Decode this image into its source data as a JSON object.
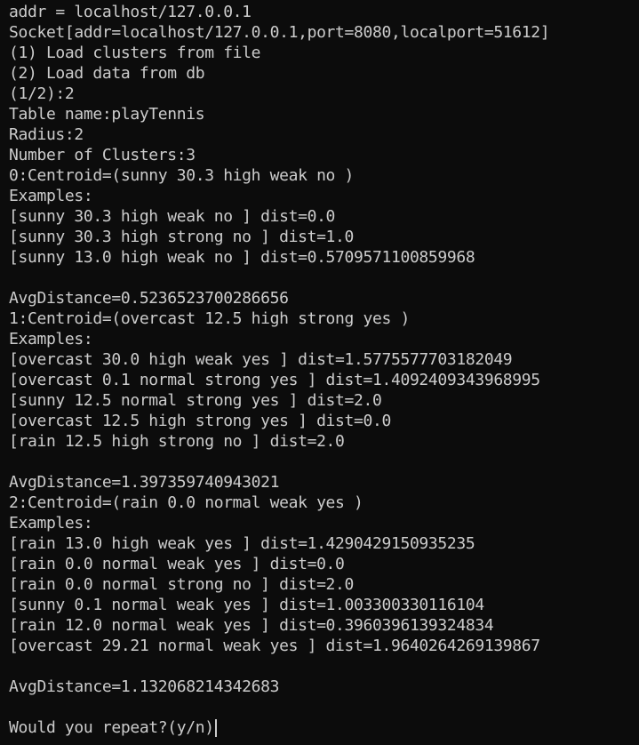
{
  "terminal": {
    "lines": [
      "addr = localhost/127.0.0.1",
      "Socket[addr=localhost/127.0.0.1,port=8080,localport=51612]",
      "(1) Load clusters from file",
      "(2) Load data from db",
      "(1/2):2",
      "Table name:playTennis",
      "Radius:2",
      "Number of Clusters:3",
      "0:Centroid=(sunny 30.3 high weak no )",
      "Examples:",
      "[sunny 30.3 high weak no ] dist=0.0",
      "[sunny 30.3 high strong no ] dist=1.0",
      "[sunny 13.0 high weak no ] dist=0.5709571100859968",
      "",
      "AvgDistance=0.5236523700286656",
      "1:Centroid=(overcast 12.5 high strong yes )",
      "Examples:",
      "[overcast 30.0 high weak yes ] dist=1.5775577703182049",
      "[overcast 0.1 normal strong yes ] dist=1.4092409343968995",
      "[sunny 12.5 normal strong yes ] dist=2.0",
      "[overcast 12.5 high strong yes ] dist=0.0",
      "[rain 12.5 high strong no ] dist=2.0",
      "",
      "AvgDistance=1.397359740943021",
      "2:Centroid=(rain 0.0 normal weak yes )",
      "Examples:",
      "[rain 13.0 high weak yes ] dist=1.4290429150935235",
      "[rain 0.0 normal weak yes ] dist=0.0",
      "[rain 0.0 normal strong no ] dist=2.0",
      "[sunny 0.1 normal weak yes ] dist=1.003300330116104",
      "[rain 12.0 normal weak yes ] dist=0.3960396139324834",
      "[overcast 29.21 normal weak yes ] dist=1.9640264269139867",
      "",
      "AvgDistance=1.132068214342683",
      ""
    ],
    "prompt": "Would you repeat?(y/n)",
    "colors": {
      "background": "#0c0c0c",
      "foreground": "#cccccc"
    }
  }
}
